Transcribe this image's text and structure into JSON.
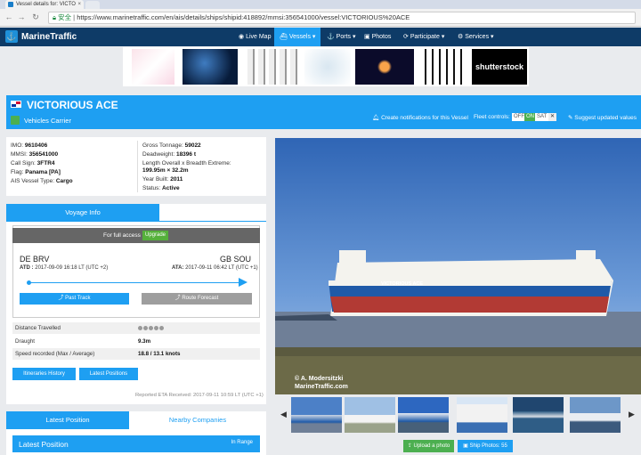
{
  "browser": {
    "tab_title": "Vessel details for: VICTO",
    "url_secure": "安全",
    "url_text": "https://www.marinetraffic.com/en/ais/details/ships/shipid:418892/mmsi:356541000/vessel:VICTORIOUS%20ACE"
  },
  "header": {
    "logo": "MarineTraffic",
    "menu": [
      {
        "label": "Live Map",
        "icon": "globe-icon"
      },
      {
        "label": "Vessels",
        "icon": "ship-icon",
        "active": true
      },
      {
        "label": "Ports",
        "icon": "anchor-icon"
      },
      {
        "label": "Photos",
        "icon": "camera-icon"
      },
      {
        "label": "Participate",
        "icon": "refresh-icon"
      },
      {
        "label": "Services",
        "icon": "gear-icon"
      }
    ],
    "ad_text": "shutterstock"
  },
  "vessel": {
    "name": "VICTORIOUS ACE",
    "type": "Vehicles Carrier",
    "notify_label": "Create notifications for this Vessel",
    "fleet_label": "Fleet controls:",
    "fleet_options": [
      "OFF",
      "ON",
      "SAT"
    ],
    "suggest_label": "Suggest updated values"
  },
  "particulars": {
    "left": [
      {
        "k": "IMO:",
        "v": "9610406"
      },
      {
        "k": "MMSI:",
        "v": "356541000"
      },
      {
        "k": "Call Sign:",
        "v": "3FTR4"
      },
      {
        "k": "Flag:",
        "v": "Panama [PA]"
      },
      {
        "k": "AIS Vessel Type:",
        "v": "Cargo"
      }
    ],
    "right": [
      {
        "k": "Gross Tonnage:",
        "v": "59022"
      },
      {
        "k": "Deadweight:",
        "v": "18396 t"
      },
      {
        "k": "Length Overall x Breadth Extreme:",
        "v": ""
      },
      {
        "k": "",
        "v": "199.95m × 32.2m"
      },
      {
        "k": "Year Built:",
        "v": "2011"
      },
      {
        "k": "Status:",
        "v": "Active"
      }
    ]
  },
  "voyage": {
    "tab": "Voyage Info",
    "full_access": "For full access",
    "upgrade": "Upgrade",
    "dep_cc": "DE",
    "dep_port": "BRV",
    "arr_cc": "GB",
    "arr_port": "SOU",
    "atd_label": "ATD :",
    "atd": "2017-09-09 16:18 LT (UTC +2)",
    "ata_label": "ATA:",
    "ata": "2017-09-11 06:42 LT (UTC +1)",
    "past_track": "Past Track",
    "route_forecast": "Route Forecast",
    "rows": [
      {
        "k": "Distance Travelled",
        "v": ""
      },
      {
        "k": "Draught",
        "v": "9.3m"
      },
      {
        "k": "Speed recorded (Max / Average)",
        "v": "18.8 / 13.1 knots"
      }
    ],
    "itineraries": "Itineraries History",
    "latest_positions": "Latest Positions",
    "eta": "Reported ETA Received: 2017-09-11 10:59 LT (UTC +1)"
  },
  "lower": {
    "tab1": "Latest Position",
    "tab2": "Nearby Companies",
    "latest_title": "Latest Position",
    "in_range": "In Range"
  },
  "photo": {
    "hull_text": "VICTORIOUS ACE",
    "credit1": "© A. Modersitzki",
    "credit2": "MarineTraffic.com",
    "upload": "Upload a photo",
    "ship_photos": "Ship Photos: 55"
  },
  "colors": {
    "accent": "#1e9ff2",
    "navy": "#0e3b67",
    "green": "#4caf50"
  }
}
